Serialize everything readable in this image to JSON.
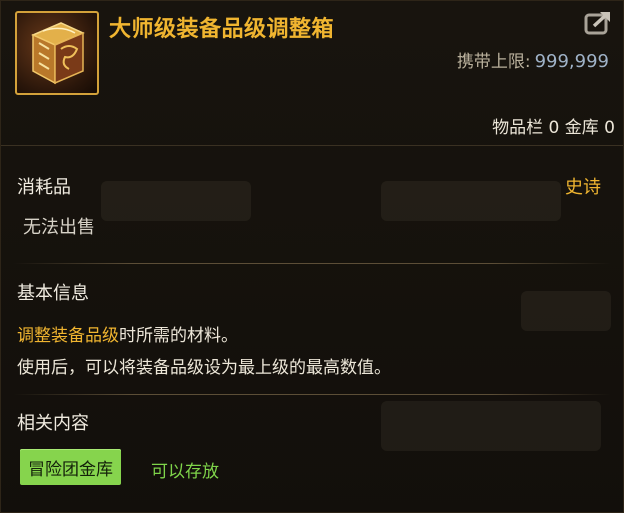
{
  "item": {
    "title": "大师级装备品级调整箱",
    "icon": "golden-box-icon",
    "limit_label": "携带上限:",
    "limit_value": "999,999",
    "storage_text": "物品栏 0 金库 0"
  },
  "info": {
    "category": "消耗品",
    "rarity": "史诗",
    "trade": "无法出售"
  },
  "basic": {
    "title": "基本信息",
    "line1_highlight": "调整装备品级",
    "line1_rest": "时所需的材料。",
    "line2": "使用后，可以将装备品级设为最上级的最高数值。"
  },
  "related": {
    "title": "相关内容",
    "tag_label": "冒险团金库",
    "tag_note": "可以存放"
  },
  "colors": {
    "gold": "#f0b530",
    "green": "#86d44d",
    "green_text": "#7fd54a",
    "value_blue": "#9fb2c7"
  }
}
